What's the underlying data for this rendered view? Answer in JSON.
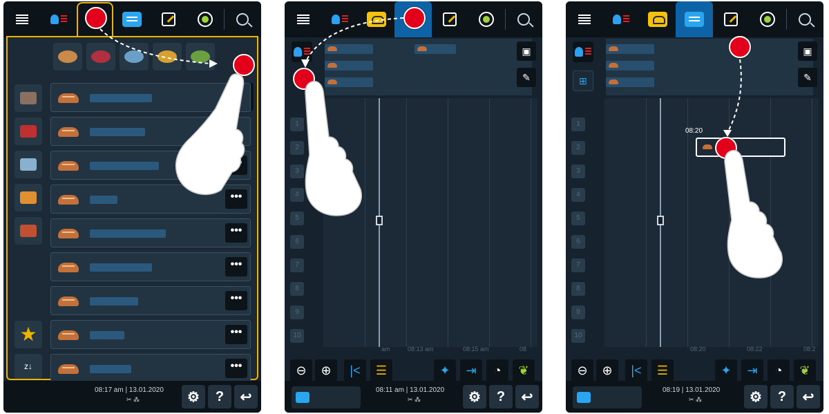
{
  "panels": [
    {
      "bottom": {
        "time": "08:17 am",
        "date": "13.01.2020"
      }
    },
    {
      "bottom": {
        "time": "08:11 am",
        "date": "13.01.2020"
      },
      "ticks": [
        "am",
        "08:13 am",
        "08:15 am",
        "08"
      ],
      "rows": [
        "1",
        "2",
        "3",
        "4",
        "5",
        "6",
        "7",
        "8",
        "9",
        "10"
      ]
    },
    {
      "bottom": {
        "time": "08:19",
        "date": "13.01.2020"
      },
      "selected_time": "08:20",
      "ticks": [
        "08:20",
        "08:22",
        "08:2"
      ],
      "rows": [
        "1",
        "2",
        "3",
        "4",
        "5",
        "6",
        "7",
        "8",
        "9",
        "10"
      ]
    }
  ],
  "labels": {
    "more": "•••",
    "help": "?",
    "back": "↩",
    "settings": "⚙",
    "trash": "🗑",
    "zoom_out": "⊖",
    "zoom_in": "⊕",
    "prev": "|<",
    "sort": "z↓"
  },
  "colors": {
    "accent": "#f0b400",
    "blue": "#2aa6f0",
    "red": "#e3001b",
    "bg": "#16232f"
  },
  "icons": [
    "menu-icon",
    "burner-icon",
    "basket-icon",
    "list-icon",
    "edit-icon",
    "refresh-plus-icon",
    "search-icon"
  ]
}
